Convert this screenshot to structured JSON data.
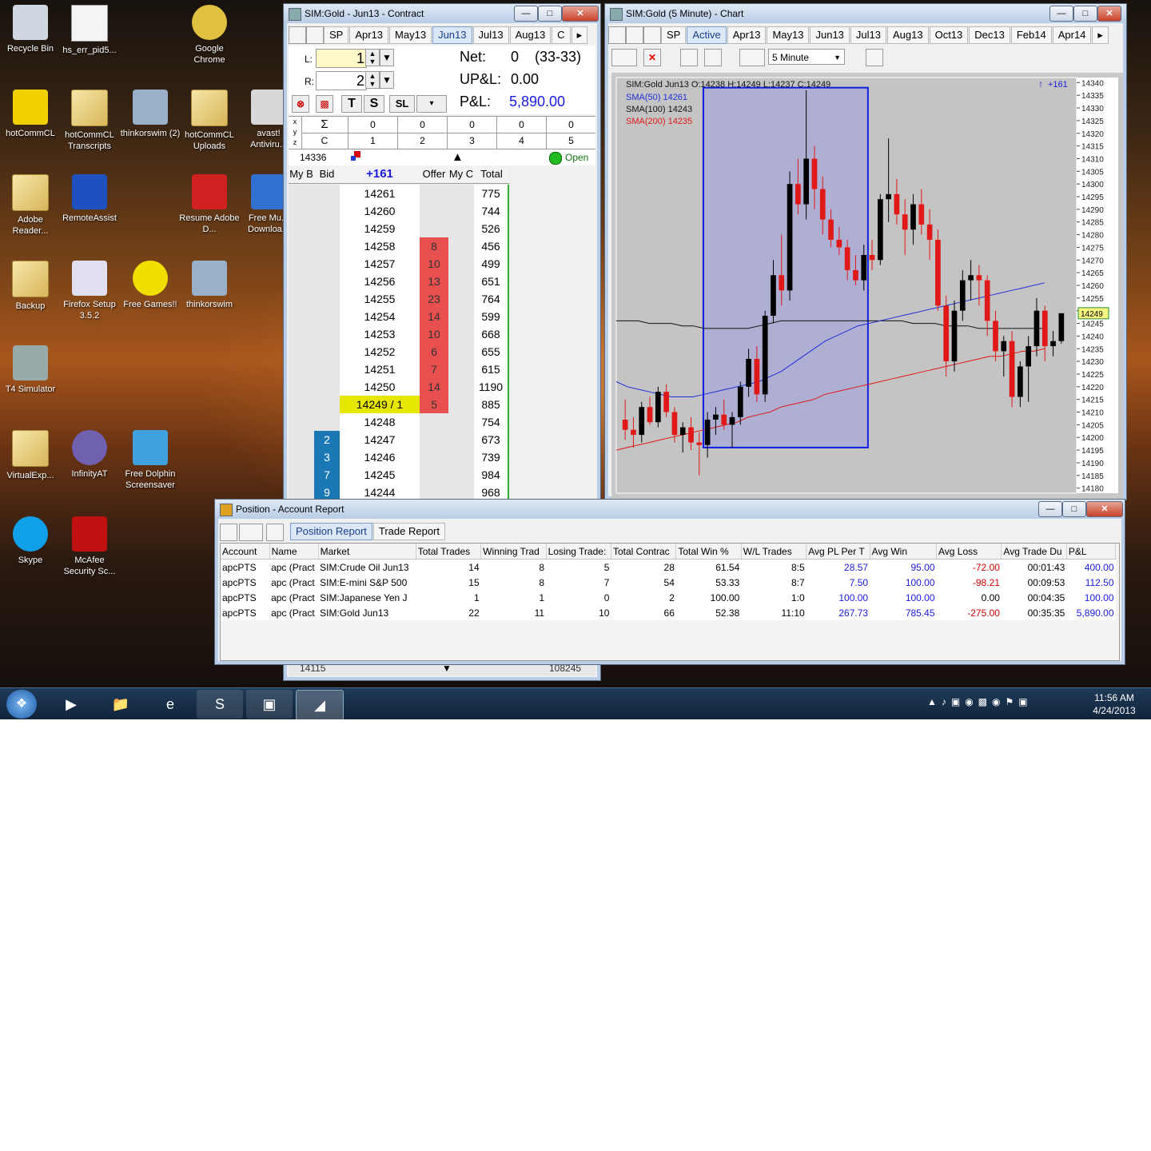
{
  "desktop": {
    "icons": [
      {
        "label": "Recycle Bin",
        "icon": "recycle-bin-icon"
      },
      {
        "label": "hs_err_pid5...",
        "icon": "document-icon"
      },
      {
        "label": "Google Chrome",
        "icon": "chrome-icon"
      },
      {
        "label": "hotCommCL",
        "icon": "hotcomm-icon"
      },
      {
        "label": "hotCommCL Transcripts",
        "icon": "folder-icon"
      },
      {
        "label": "thinkorswim (2)",
        "icon": "thinkorswim-icon"
      },
      {
        "label": "hotCommCL Uploads",
        "icon": "folder-icon"
      },
      {
        "label": "avast! Antiviru...",
        "icon": "avast-icon"
      },
      {
        "label": "Adobe Reader...",
        "icon": "folder-icon"
      },
      {
        "label": "RemoteAssist",
        "icon": "remoteassist-icon"
      },
      {
        "label": "Resume Adobe D...",
        "icon": "adobe-icon"
      },
      {
        "label": "Free Mu... Downloa...",
        "icon": "music-icon"
      },
      {
        "label": "Backup",
        "icon": "folder-icon"
      },
      {
        "label": "Firefox Setup 3.5.2",
        "icon": "installer-icon"
      },
      {
        "label": "Free Games!!",
        "icon": "pacman-icon"
      },
      {
        "label": "thinkorswim",
        "icon": "thinkorswim-icon"
      },
      {
        "label": "T4 Simulator",
        "icon": "t4-icon"
      },
      {
        "label": "VirtualExp...",
        "icon": "folder-icon"
      },
      {
        "label": "InfinityAT",
        "icon": "infinity-icon"
      },
      {
        "label": "Free Dolphin Screensaver",
        "icon": "dolphin-icon"
      },
      {
        "label": "Skype",
        "icon": "skype-icon"
      },
      {
        "label": "McAfee Security Sc...",
        "icon": "mcafee-icon"
      }
    ]
  },
  "contract_window": {
    "title": "SIM:Gold - Jun13 - Contract",
    "sp_label": "SP",
    "tabs": [
      "Apr13",
      "May13",
      "Jun13",
      "Jul13",
      "Aug13",
      "C"
    ],
    "active_tab": "Jun13",
    "l_label": "L:",
    "l_value": "1",
    "r_label": "R:",
    "r_value": "2",
    "net_label": "Net:",
    "net_value": "0",
    "net_range": "(33-33)",
    "upl_label": "UP&L:",
    "upl_value": "0.00",
    "pl_label": "P&L:",
    "pl_value": "5,890.00",
    "tool_t": "T",
    "tool_s": "S",
    "tool_sl": "SL",
    "grid_row1_head": "Σ",
    "grid_row1": [
      "0",
      "0",
      "0",
      "0",
      "0"
    ],
    "grid_row2_head": "C",
    "grid_row2": [
      "1",
      "2",
      "3",
      "4",
      "5"
    ],
    "grid_side": [
      "x",
      "y",
      "z"
    ],
    "ticker_value": "14336",
    "status": "Open",
    "footer_left": "14115",
    "footer_right": "108245",
    "headers": {
      "my_bid": "My B",
      "bid": "Bid",
      "price": "+161",
      "offer": "Offer",
      "my_offer": "My C",
      "total": "Total"
    },
    "ladder": [
      {
        "price": "14261",
        "bid": "",
        "offer": "",
        "total": "775"
      },
      {
        "price": "14260",
        "bid": "",
        "offer": "",
        "total": "744"
      },
      {
        "price": "14259",
        "bid": "",
        "offer": "",
        "total": "526"
      },
      {
        "price": "14258",
        "bid": "",
        "offer": "8",
        "total": "456"
      },
      {
        "price": "14257",
        "bid": "",
        "offer": "10",
        "total": "499"
      },
      {
        "price": "14256",
        "bid": "",
        "offer": "13",
        "total": "651"
      },
      {
        "price": "14255",
        "bid": "",
        "offer": "23",
        "total": "764"
      },
      {
        "price": "14254",
        "bid": "",
        "offer": "14",
        "total": "599"
      },
      {
        "price": "14253",
        "bid": "",
        "offer": "10",
        "total": "668"
      },
      {
        "price": "14252",
        "bid": "",
        "offer": "6",
        "total": "655"
      },
      {
        "price": "14251",
        "bid": "",
        "offer": "7",
        "total": "615"
      },
      {
        "price": "14250",
        "bid": "",
        "offer": "14",
        "total": "1190"
      },
      {
        "price": "14249 / 1",
        "bid": "",
        "offer": "5",
        "total": "885",
        "last": true
      },
      {
        "price": "14248",
        "bid": "",
        "offer": "",
        "total": "754"
      },
      {
        "price": "14247",
        "bid": "2",
        "offer": "",
        "total": "673"
      },
      {
        "price": "14246",
        "bid": "3",
        "offer": "",
        "total": "739"
      },
      {
        "price": "14245",
        "bid": "7",
        "offer": "",
        "total": "984"
      },
      {
        "price": "14244",
        "bid": "9",
        "offer": "",
        "total": "968"
      }
    ]
  },
  "chart_window": {
    "title": "SIM:Gold (5 Minute) - Chart",
    "sp_label": "SP",
    "tabs": [
      "Active",
      "Apr13",
      "May13",
      "Jun13",
      "Jul13",
      "Aug13",
      "Oct13",
      "Dec13",
      "Feb14",
      "Apr14"
    ],
    "active_tab": "Active",
    "interval": "5 Minute",
    "ohlc_label": "SIM:Gold Jun13 O:14238 H:14249 L:14237 C:14249",
    "badge": "+161",
    "current_price": "14249",
    "legend": [
      {
        "label": "SMA(50)  14261",
        "color": "#1f2fd6"
      },
      {
        "label": "SMA(100)  14243",
        "color": "#111111"
      },
      {
        "label": "SMA(200)  14235",
        "color": "#e01818"
      }
    ],
    "y_ticks": [
      "14340",
      "14335",
      "14330",
      "14325",
      "14320",
      "14315",
      "14310",
      "14305",
      "14300",
      "14295",
      "14290",
      "14285",
      "14280",
      "14275",
      "14270",
      "14265",
      "14260",
      "14255",
      "14250",
      "14245",
      "14240",
      "14235",
      "14230",
      "14225",
      "14220",
      "14215",
      "14210",
      "14205",
      "14200",
      "14195",
      "14190",
      "14185",
      "14180"
    ]
  },
  "chart_data": {
    "type": "candlestick",
    "title": "SIM:Gold Jun13",
    "ylim": [
      14178,
      14342
    ],
    "candles": [
      [
        14207,
        14215,
        14199,
        14203
      ],
      [
        14203,
        14208,
        14196,
        14201
      ],
      [
        14201,
        14214,
        14198,
        14212
      ],
      [
        14212,
        14216,
        14205,
        14206
      ],
      [
        14206,
        14220,
        14204,
        14218
      ],
      [
        14218,
        14221,
        14208,
        14210
      ],
      [
        14210,
        14212,
        14198,
        14201
      ],
      [
        14201,
        14206,
        14194,
        14204
      ],
      [
        14204,
        14208,
        14195,
        14198
      ],
      [
        14198,
        14202,
        14185,
        14197
      ],
      [
        14197,
        14210,
        14192,
        14207
      ],
      [
        14207,
        14212,
        14201,
        14209
      ],
      [
        14209,
        14215,
        14203,
        14205
      ],
      [
        14205,
        14210,
        14196,
        14208
      ],
      [
        14208,
        14222,
        14205,
        14220
      ],
      [
        14220,
        14235,
        14216,
        14231
      ],
      [
        14231,
        14236,
        14214,
        14217
      ],
      [
        14217,
        14250,
        14214,
        14248
      ],
      [
        14248,
        14270,
        14245,
        14264
      ],
      [
        14264,
        14280,
        14252,
        14258
      ],
      [
        14258,
        14305,
        14254,
        14300
      ],
      [
        14300,
        14310,
        14288,
        14292
      ],
      [
        14292,
        14337,
        14286,
        14310
      ],
      [
        14310,
        14315,
        14290,
        14298
      ],
      [
        14298,
        14303,
        14280,
        14286
      ],
      [
        14286,
        14290,
        14275,
        14278
      ],
      [
        14278,
        14283,
        14272,
        14275
      ],
      [
        14275,
        14278,
        14262,
        14266
      ],
      [
        14266,
        14272,
        14260,
        14262
      ],
      [
        14262,
        14276,
        14258,
        14272
      ],
      [
        14272,
        14278,
        14266,
        14270
      ],
      [
        14270,
        14296,
        14268,
        14294
      ],
      [
        14294,
        14318,
        14285,
        14296
      ],
      [
        14296,
        14302,
        14284,
        14288
      ],
      [
        14288,
        14294,
        14272,
        14282
      ],
      [
        14282,
        14296,
        14276,
        14292
      ],
      [
        14292,
        14298,
        14280,
        14284
      ],
      [
        14284,
        14290,
        14270,
        14278
      ],
      [
        14278,
        14282,
        14250,
        14252
      ],
      [
        14252,
        14256,
        14224,
        14230
      ],
      [
        14230,
        14254,
        14226,
        14250
      ],
      [
        14250,
        14266,
        14246,
        14262
      ],
      [
        14262,
        14270,
        14254,
        14264
      ],
      [
        14264,
        14268,
        14252,
        14262
      ],
      [
        14262,
        14264,
        14240,
        14246
      ],
      [
        14246,
        14250,
        14230,
        14234
      ],
      [
        14234,
        14240,
        14224,
        14238
      ],
      [
        14238,
        14242,
        14212,
        14216
      ],
      [
        14216,
        14230,
        14212,
        14228
      ],
      [
        14228,
        14240,
        14214,
        14236
      ],
      [
        14236,
        14255,
        14232,
        14250
      ],
      [
        14250,
        14252,
        14230,
        14236
      ],
      [
        14236,
        14242,
        14232,
        14238
      ],
      [
        14238,
        14249,
        14237,
        14249
      ]
    ],
    "sma50": [
      14222,
      14220,
      14219,
      14218,
      14217,
      14216,
      14216,
      14216,
      14217,
      14218,
      14219,
      14220,
      14221,
      14222,
      14224,
      14226,
      14229,
      14232,
      14235,
      14238,
      14240,
      14242,
      14244,
      14245,
      14246,
      14247,
      14248,
      14249,
      14250,
      14251,
      14252,
      14253,
      14254,
      14255,
      14256,
      14257,
      14258,
      14259,
      14260,
      14261
    ],
    "sma100": [
      14246,
      14246,
      14246,
      14245,
      14245,
      14245,
      14244,
      14244,
      14243,
      14243,
      14243,
      14243,
      14243,
      14244,
      14245,
      14246,
      14246,
      14246,
      14246,
      14246,
      14246,
      14246,
      14246,
      14246,
      14246,
      14246,
      14246,
      14245,
      14245,
      14245,
      14244,
      14244,
      14244,
      14243,
      14243,
      14243,
      14243,
      14243,
      14243,
      14243
    ],
    "sma200": [
      14195,
      14196,
      14197,
      14198,
      14199,
      14200,
      14201,
      14202,
      14203,
      14204,
      14205,
      14206,
      14208,
      14209,
      14210,
      14212,
      14213,
      14214,
      14215,
      14217,
      14218,
      14219,
      14220,
      14221,
      14222,
      14223,
      14224,
      14225,
      14226,
      14227,
      14228,
      14229,
      14230,
      14231,
      14232,
      14232,
      14233,
      14234,
      14234,
      14235
    ],
    "highlight_range": {
      "from_index": 10,
      "to_index": 29
    }
  },
  "report_window": {
    "title": "Position - Account Report",
    "tabs": [
      "Position Report",
      "Trade Report"
    ],
    "active_tab": "Position Report",
    "columns": [
      "Account",
      "Name",
      "Market",
      "Total Trades",
      "Winning Trad",
      "Losing Trade:",
      "Total Contrac",
      "Total Win %",
      "W/L Trades",
      "Avg PL Per T",
      "Avg Win",
      "Avg Loss",
      "Avg Trade Du",
      "P&L"
    ],
    "rows": [
      [
        "apcPTS",
        "apc (Pract",
        "SIM:Crude Oil Jun13",
        "14",
        "8",
        "5",
        "28",
        "61.54",
        "8:5",
        "28.57",
        "95.00",
        "-72.00",
        "00:01:43",
        "400.00"
      ],
      [
        "apcPTS",
        "apc (Pract",
        "SIM:E-mini S&P 500",
        "15",
        "8",
        "7",
        "54",
        "53.33",
        "8:7",
        "7.50",
        "100.00",
        "-98.21",
        "00:09:53",
        "112.50"
      ],
      [
        "apcPTS",
        "apc (Pract",
        "SIM:Japanese Yen J",
        "1",
        "1",
        "0",
        "2",
        "100.00",
        "1:0",
        "100.00",
        "100.00",
        "0.00",
        "00:04:35",
        "100.00"
      ],
      [
        "apcPTS",
        "apc (Pract",
        "SIM:Gold Jun13",
        "22",
        "11",
        "10",
        "66",
        "52.38",
        "11:10",
        "267.73",
        "785.45",
        "-275.00",
        "00:35:35",
        "5,890.00"
      ]
    ]
  },
  "taskbar": {
    "time": "11:56 AM",
    "date": "4/24/2013",
    "start_icon": "windows-start-icon",
    "pinned": [
      "media-player-icon",
      "explorer-icon",
      "internet-explorer-icon",
      "skype-icon",
      "thinkorswim-icon",
      "t4-icon"
    ]
  },
  "colors": {
    "offer": "#e85050",
    "bid": "#1a78b4",
    "last_price": "#e6e600",
    "blue_text": "#1a1ae0",
    "red_text": "#d00000"
  }
}
